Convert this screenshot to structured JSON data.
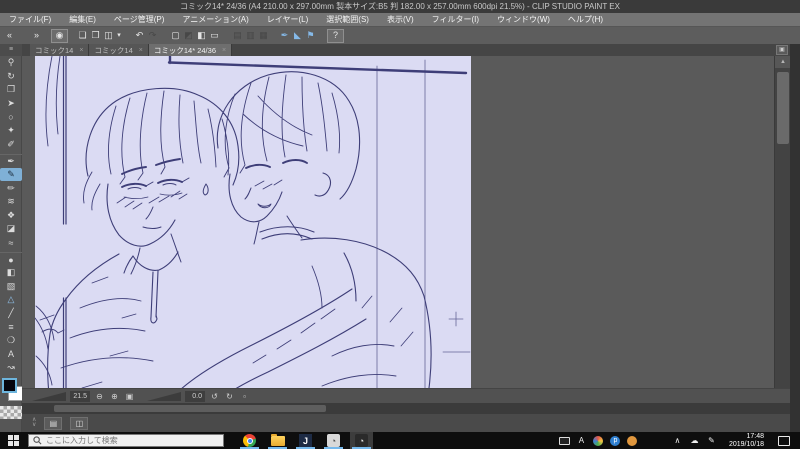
{
  "window": {
    "title": "コミック14* 24/36 (A4 210.00 x 297.00mm 製本サイズ:B5 判 182.00 x 257.00mm 600dpi 21.5%) - CLIP STUDIO PAINT EX"
  },
  "menu": {
    "items": [
      "ファイル(F)",
      "編集(E)",
      "ページ管理(P)",
      "アニメーション(A)",
      "レイヤー(L)",
      "選択範囲(S)",
      "表示(V)",
      "フィルター(I)",
      "ウィンドウ(W)",
      "ヘルプ(H)"
    ]
  },
  "toolbar": {
    "buttons": [
      {
        "name": "nav-back",
        "glyph": "«"
      },
      {
        "name": "nav-forward",
        "glyph": "»"
      },
      {
        "name": "clip-studio-home",
        "glyph": "◉"
      },
      {
        "name": "new-file",
        "glyph": "❏"
      },
      {
        "name": "open-file",
        "glyph": "❒"
      },
      {
        "name": "save-file",
        "glyph": "◫"
      },
      {
        "name": "save-menu",
        "glyph": "▾"
      },
      {
        "name": "undo",
        "glyph": "↶"
      },
      {
        "name": "redo",
        "glyph": "↷"
      },
      {
        "name": "deselect",
        "glyph": "▢"
      },
      {
        "name": "invert-selection",
        "glyph": "◩"
      },
      {
        "name": "fill-selection",
        "glyph": "◧"
      },
      {
        "name": "transform",
        "glyph": "▭"
      },
      {
        "name": "layer-op-1",
        "glyph": "▤"
      },
      {
        "name": "layer-op-2",
        "glyph": "▥"
      },
      {
        "name": "layer-op-3",
        "glyph": "▦"
      },
      {
        "name": "snap-ruler",
        "glyph": "✒"
      },
      {
        "name": "snap-special-ruler",
        "glyph": "◣"
      },
      {
        "name": "snap-grid",
        "glyph": "⚑"
      },
      {
        "name": "help",
        "glyph": "?"
      }
    ]
  },
  "tabs": {
    "close_glyph": "×",
    "list_button_glyph": "▣",
    "items": [
      {
        "label": "コミック14"
      },
      {
        "label": "コミック14"
      },
      {
        "label": "コミック14* 24/36"
      }
    ]
  },
  "tools": {
    "header_glyph": "≡",
    "fg_color": "#000000",
    "bg_color": "#ffffff",
    "items": [
      {
        "name": "zoom-tool",
        "glyph": "⚲"
      },
      {
        "name": "rotate-tool",
        "glyph": "↻"
      },
      {
        "name": "move-tool",
        "glyph": "❐"
      },
      {
        "name": "object-tool",
        "glyph": "➤"
      },
      {
        "name": "lasso-tool",
        "glyph": "○"
      },
      {
        "name": "auto-select-tool",
        "glyph": "✦"
      },
      {
        "name": "eyedropper-tool",
        "glyph": "✐"
      },
      {
        "name": "pen-tool",
        "glyph": "✒"
      },
      {
        "name": "pencil-tool",
        "glyph": "✎"
      },
      {
        "name": "brush-tool",
        "glyph": "✏"
      },
      {
        "name": "airbrush-tool",
        "glyph": "≋"
      },
      {
        "name": "decoration-tool",
        "glyph": "❖"
      },
      {
        "name": "eraser-tool",
        "glyph": "◪"
      },
      {
        "name": "blend-tool",
        "glyph": "≈"
      },
      {
        "name": "liquify-tool",
        "glyph": "●"
      },
      {
        "name": "fill-tool",
        "glyph": "◧"
      },
      {
        "name": "gradient-tool",
        "glyph": "▧"
      },
      {
        "name": "figure-tool",
        "glyph": "△"
      },
      {
        "name": "line-tool",
        "glyph": "╱"
      },
      {
        "name": "saturated-lines-tool",
        "glyph": "≡"
      },
      {
        "name": "balloon-tool",
        "glyph": "❍"
      },
      {
        "name": "text-tool",
        "glyph": "A"
      },
      {
        "name": "line-correction-tool",
        "glyph": "↝"
      }
    ]
  },
  "canvas": {
    "zoom_value": "21.5",
    "rotation_value": "0.0",
    "zoom_out_glyph": "⊖",
    "zoom_in_glyph": "⊕",
    "fit_glyph": "▣",
    "rotate_ccw_glyph": "↺",
    "rotate_cw_glyph": "↻",
    "reset_glyph": "▫",
    "scroll_up_glyph": "▲"
  },
  "bottom_bar": {
    "up_glyph": "∧",
    "down_glyph": "∨",
    "panel_button_glyph": "▤",
    "view_button_glyph": "◫"
  },
  "taskbar": {
    "search_placeholder": "ここに入力して検索",
    "apps": {
      "j_glyph": "J",
      "cs_glyph": "◔",
      "csp_glyph": "◔"
    },
    "tray": {
      "ime_glyph": "A",
      "blue_glyph": "p",
      "chevron_glyph": "∧",
      "cloud_glyph": "☁",
      "pen_glyph": "✎"
    },
    "clock": {
      "time": "17:48",
      "date": "2019/10/18"
    }
  },
  "colors": {
    "accent_blue": "#7fb0d6",
    "canvas_paper": "#dbdbf3",
    "line_art": "#3e3e78",
    "taskbar_underline": "#76b9ed"
  }
}
